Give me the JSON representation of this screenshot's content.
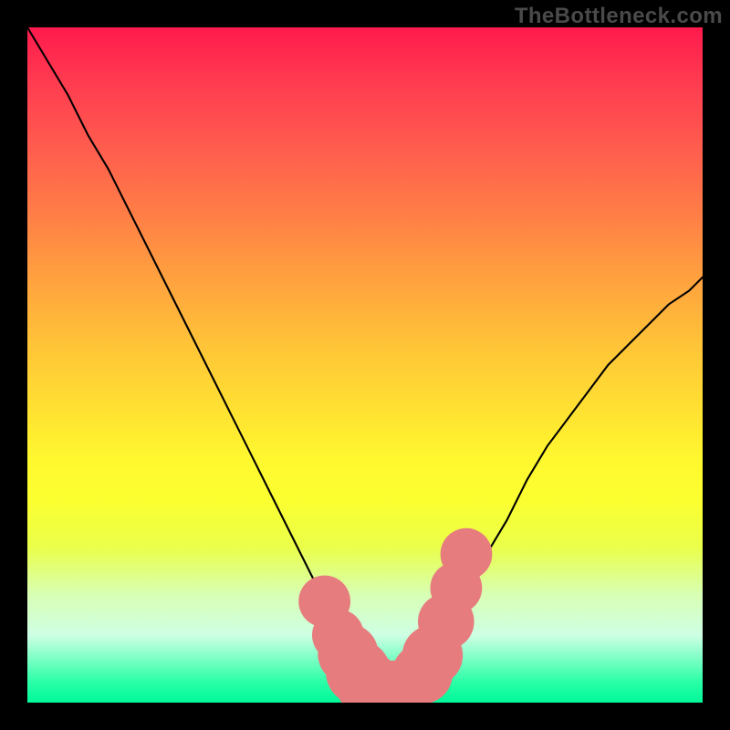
{
  "watermark": "TheBottleneck.com",
  "colors": {
    "gradient_top": "#ff1a4d",
    "gradient_mid": "#ffe531",
    "gradient_bottom": "#00f89a",
    "curve": "#000000",
    "markers": "#e77c7e",
    "frame": "#000000"
  },
  "chart_data": {
    "type": "line",
    "title": "",
    "xlabel": "",
    "ylabel": "",
    "xlim": [
      0,
      100
    ],
    "ylim": [
      0,
      100
    ],
    "grid": false,
    "legend": false,
    "series": [
      {
        "name": "bottleneck-curve",
        "x": [
          0,
          3,
          6,
          9,
          12,
          15,
          18,
          21,
          24,
          27,
          30,
          33,
          36,
          39,
          42,
          43,
          44,
          45,
          46,
          47,
          48,
          49,
          50,
          51,
          52,
          53,
          54,
          55,
          56,
          57,
          58,
          59,
          60,
          62,
          65,
          68,
          71,
          74,
          77,
          80,
          83,
          86,
          89,
          92,
          95,
          98,
          100
        ],
        "y": [
          100,
          95,
          90,
          84,
          79,
          73,
          67,
          61,
          55,
          49,
          43,
          37,
          31,
          25,
          19,
          17,
          15,
          12,
          10,
          8,
          6,
          4,
          3,
          2.5,
          2.2,
          2,
          2,
          2.2,
          2.6,
          3.2,
          4.2,
          5.6,
          7.3,
          11,
          16,
          22,
          27,
          33,
          38,
          42,
          46,
          50,
          53,
          56,
          59,
          61,
          63
        ]
      }
    ],
    "markers": [
      {
        "x": 44,
        "y": 15,
        "r": 1.2
      },
      {
        "x": 46,
        "y": 10,
        "r": 1.2
      },
      {
        "x": 47.5,
        "y": 7.2,
        "r": 1.4
      },
      {
        "x": 49,
        "y": 4.5,
        "r": 1.5
      },
      {
        "x": 50.5,
        "y": 2.7,
        "r": 1.5
      },
      {
        "x": 52.5,
        "y": 2.1,
        "r": 1.3
      },
      {
        "x": 54.5,
        "y": 2.1,
        "r": 1.3
      },
      {
        "x": 56.5,
        "y": 2.6,
        "r": 1.3
      },
      {
        "x": 58.5,
        "y": 4.3,
        "r": 1.4
      },
      {
        "x": 60,
        "y": 7.0,
        "r": 1.4
      },
      {
        "x": 62,
        "y": 12,
        "r": 1.3
      },
      {
        "x": 63.5,
        "y": 17,
        "r": 1.2
      },
      {
        "x": 65,
        "y": 22,
        "r": 1.2
      }
    ]
  }
}
